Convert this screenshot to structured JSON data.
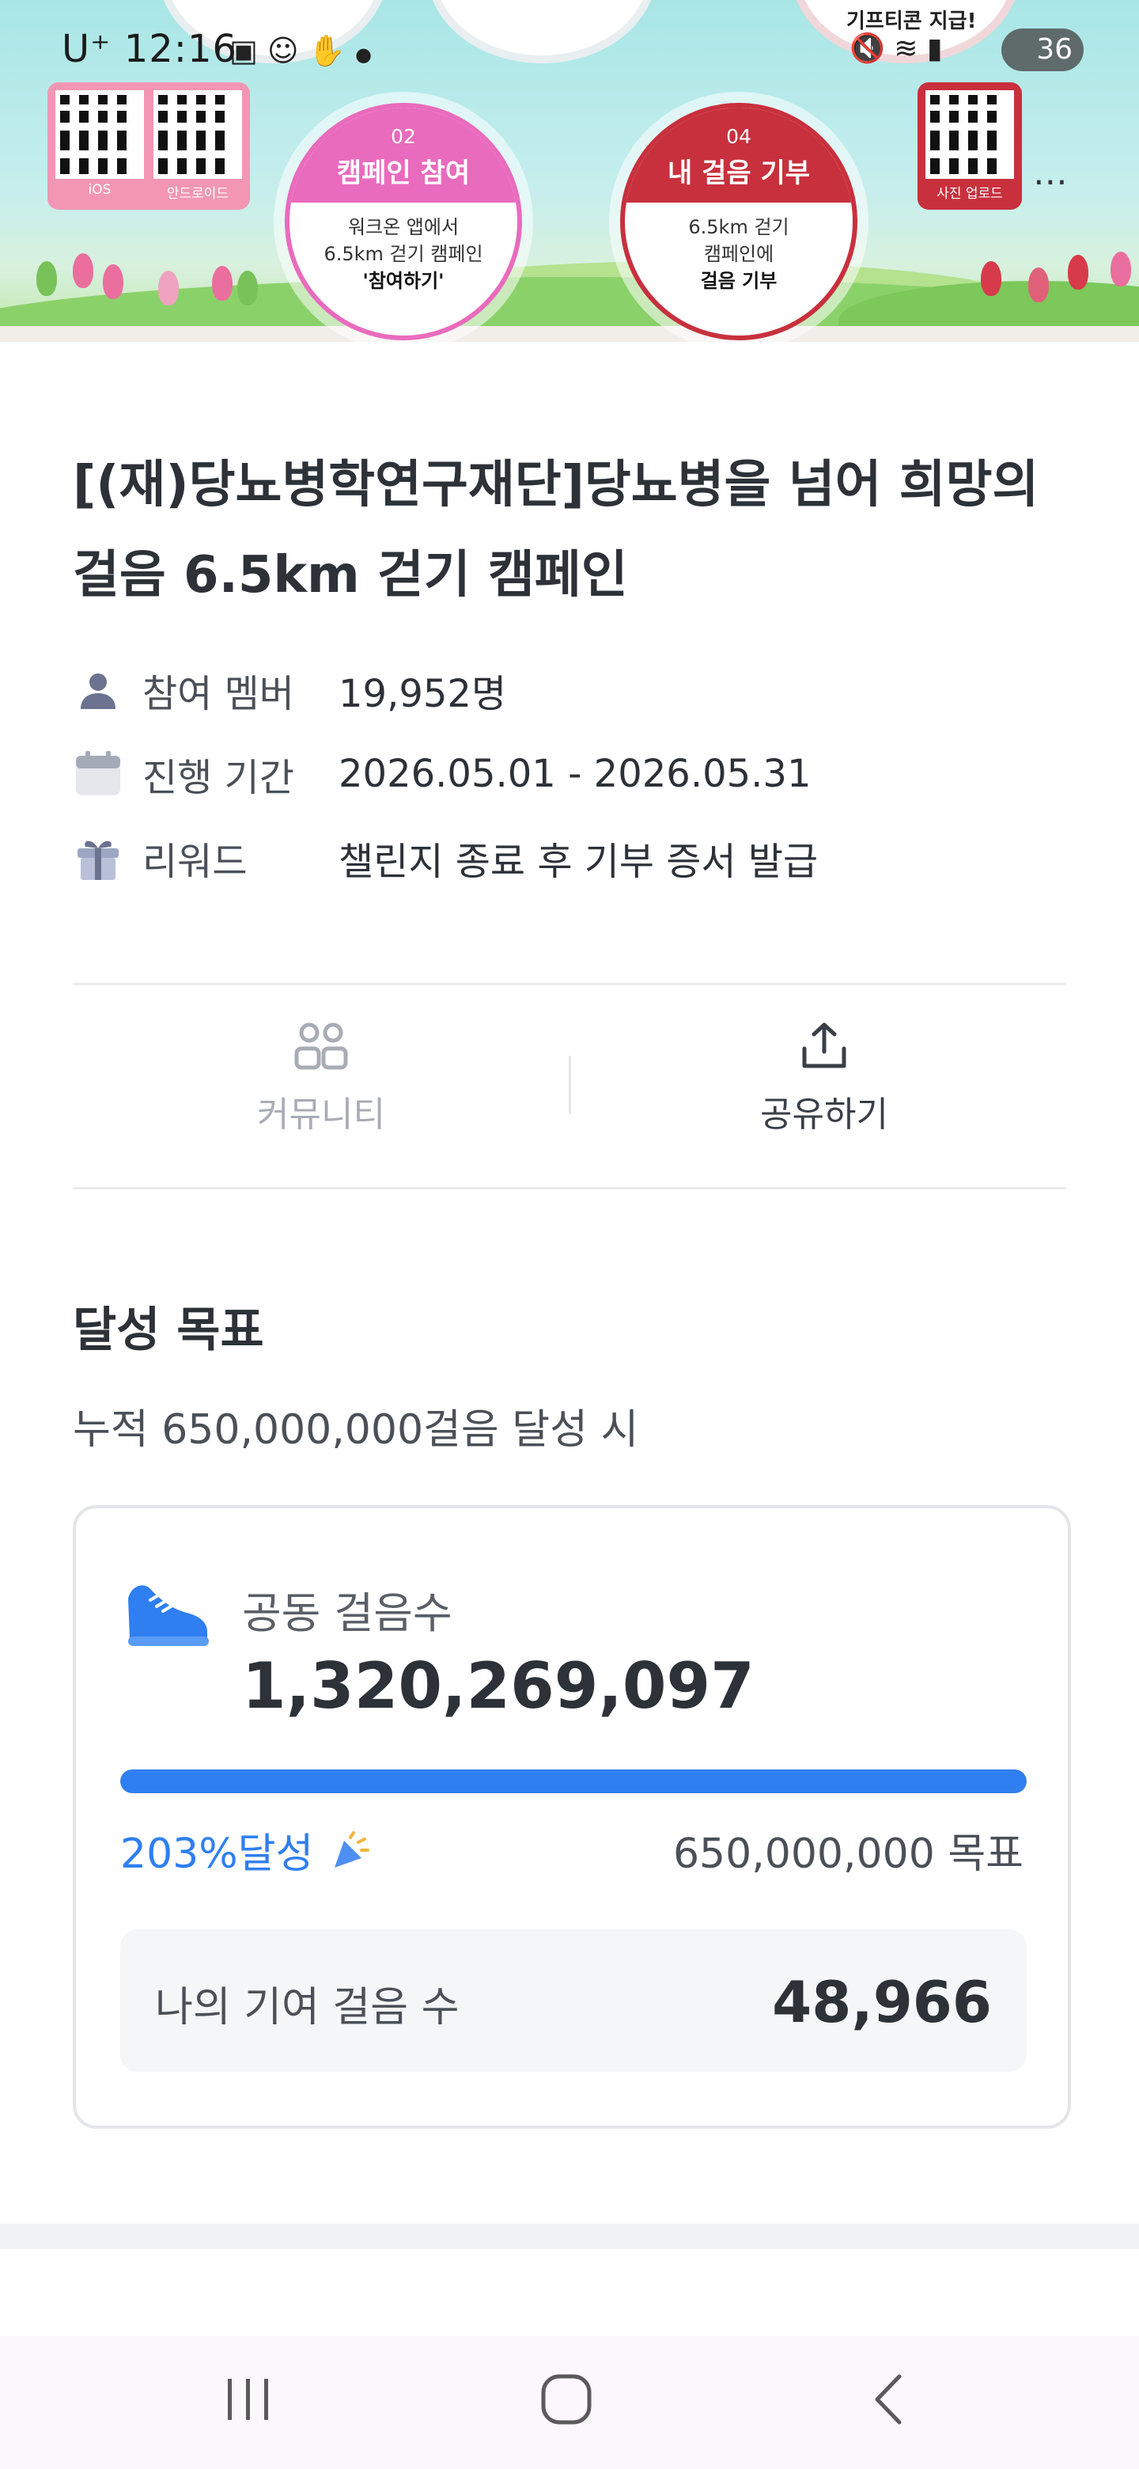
{
  "status_bar": {
    "carrier_time": "U⁺ 12:16",
    "battery": "36",
    "left_icons": [
      "screenshot-icon",
      "face-icon",
      "gesture-icon",
      "dot-icon"
    ],
    "right_icons": [
      "mute-icon",
      "wifi-icon",
      "signal-icon"
    ]
  },
  "banner": {
    "qr_left_labels": [
      "iOS",
      "안드로이드"
    ],
    "qr_right_label": "사진 업로드",
    "top_partial_text": "기프티콘 지급!",
    "step2": {
      "num": "02",
      "title": "캠페인 참여",
      "line1": "워크온 앱에서",
      "line2": "6.5km 걷기 캠페인",
      "line3": "'참여하기'"
    },
    "step4": {
      "num": "04",
      "title": "내 걸음 기부",
      "line1": "6.5km 걷기",
      "line2": "캠페인에",
      "line3": "걸음 기부"
    },
    "more": "⋯"
  },
  "campaign": {
    "title": "[(재)당뇨병학연구재단]당뇨병을 넘어 희망의 걸음 6.5km 걷기 캠페인",
    "info": [
      {
        "icon": "person-icon",
        "label": "참여 멤버",
        "value": "19,952명"
      },
      {
        "icon": "calendar-icon",
        "label": "진행 기간",
        "value": "2026.05.01 - 2026.05.31"
      },
      {
        "icon": "gift-icon",
        "label": "리워드",
        "value": "챌린지 종료 후 기부 증서 발급"
      }
    ]
  },
  "actions": {
    "community": "커뮤니티",
    "share": "공유하기"
  },
  "goal": {
    "heading": "달성 목표",
    "subtitle": "누적 650,000,000걸음 달성 시",
    "steps_label": "공동 걸음수",
    "steps_value": "1,320,269,097",
    "progress_fraction": 1.0,
    "percent_text": "203%달성",
    "target_text": "650,000,000 목표",
    "my_label": "나의 기여 걸음 수",
    "my_value": "48,966"
  },
  "colors": {
    "accent": "#2f7ff0",
    "pink": "#e96bbd",
    "red": "#c8303d"
  }
}
